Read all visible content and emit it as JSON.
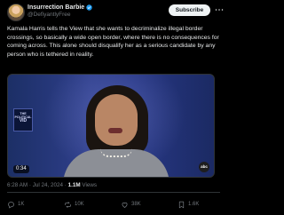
{
  "author": {
    "display_name": "Insurrection Barbie",
    "handle": "@DefiyantlyFree"
  },
  "header": {
    "subscribe_label": "Subscribe"
  },
  "tweet": {
    "text": "Kamala Harris tells the View that she wants to decriminalize illegal border crossings, so basically a wide open border, where there is no consequences for coming across. This alone should disqualify her as a serious candidate by any person who is tethered in reality."
  },
  "video": {
    "duration": "0:34",
    "overlay_logo_lines": [
      "THE",
      "POLITICAL",
      "VID"
    ],
    "network_logo": "abc"
  },
  "meta": {
    "time": "6:28 AM",
    "date": "Jul 24, 2024",
    "separator": "·",
    "views_count": "1.1M",
    "views_label": "Views"
  },
  "actions": {
    "replies": "1K",
    "reposts": "10K",
    "likes": "38K",
    "bookmarks": "1.6K"
  },
  "colors": {
    "background": "#000000",
    "text": "#e7e9ea",
    "muted": "#71767b",
    "verified": "#1d9bf0",
    "subscribe_bg": "#eff3f4"
  },
  "icons": [
    "verified-badge-icon",
    "more-icon",
    "reply-icon",
    "repost-icon",
    "like-icon",
    "bookmark-icon"
  ]
}
